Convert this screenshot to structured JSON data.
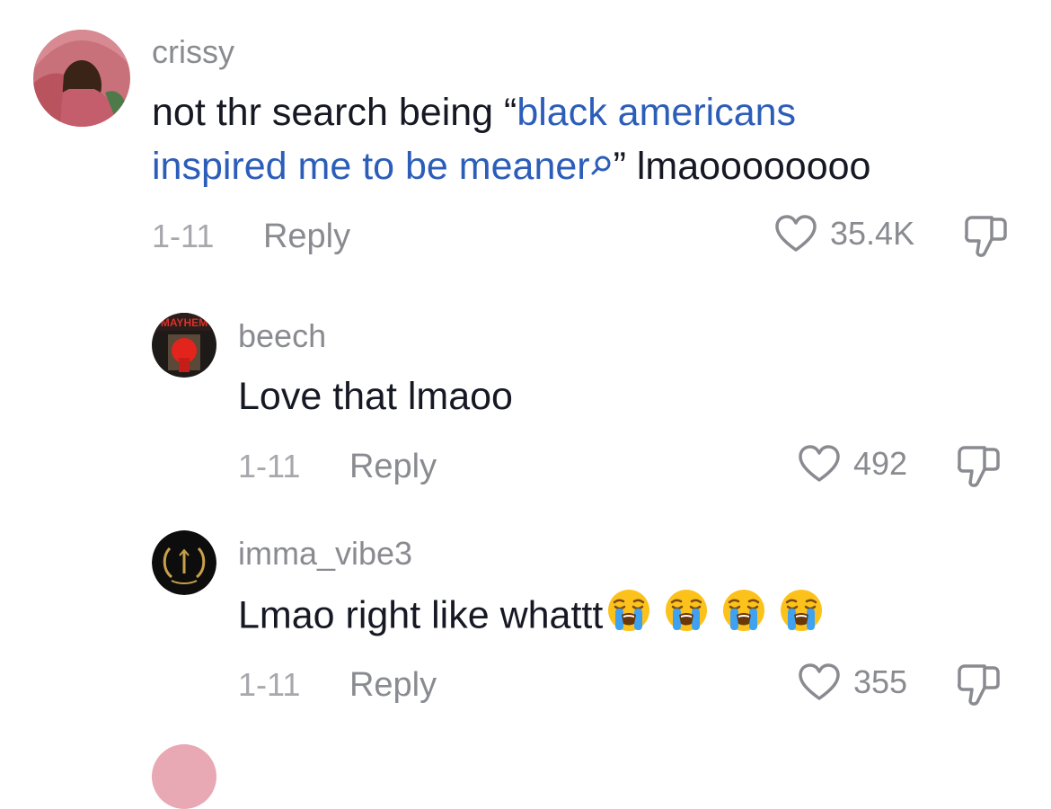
{
  "comments": [
    {
      "username": "crissy",
      "text_before": "not thr search being “",
      "link_text_line1": "black americans",
      "link_text_line2": "inspired me to be meaner",
      "text_after": "” lmaoooooooo",
      "date": "1-11",
      "reply_label": "Reply",
      "likes": "35.4K"
    },
    {
      "username": "beech",
      "text": "Love that lmaoo",
      "date": "1-11",
      "reply_label": "Reply",
      "likes": "492",
      "avatar_label": "MAYHEM"
    },
    {
      "username": "imma_vibe3",
      "text": "Lmao right like whattt",
      "emojis": [
        "loudly-crying-face",
        "loudly-crying-face",
        "loudly-crying-face",
        "loudly-crying-face"
      ],
      "date": "1-11",
      "reply_label": "Reply",
      "likes": "355"
    }
  ],
  "colors": {
    "link": "#2b5db9",
    "muted": "#8a8b91",
    "text": "#161823"
  }
}
